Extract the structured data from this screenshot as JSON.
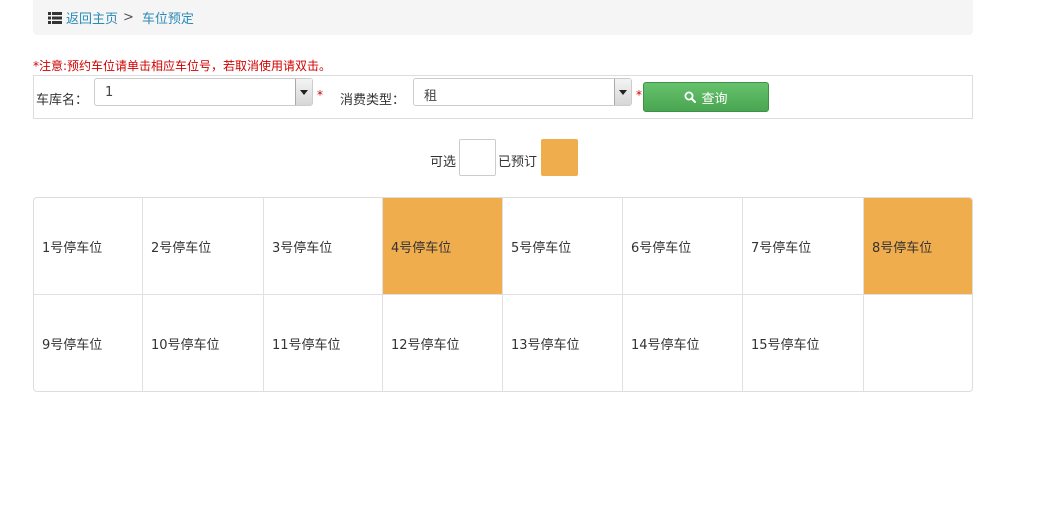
{
  "breadcrumb": {
    "home_label": "返回主页",
    "separator": ">",
    "current": "车位预定"
  },
  "notice": "*注意:预约车位请单击相应车位号，若取消使用请双击。",
  "form": {
    "garage_label": "车库名：",
    "garage_value": "1",
    "type_label": "消费类型：",
    "type_value": "租",
    "required_mark": "*",
    "query_label": "查询"
  },
  "legend": {
    "available_label": "可选",
    "booked_label": "已预订",
    "available_color": "#ffffff",
    "booked_color": "#f0ad4e"
  },
  "slots": [
    {
      "label": "1号停车位",
      "booked": false
    },
    {
      "label": "2号停车位",
      "booked": false
    },
    {
      "label": "3号停车位",
      "booked": false
    },
    {
      "label": "4号停车位",
      "booked": true
    },
    {
      "label": "5号停车位",
      "booked": false
    },
    {
      "label": "6号停车位",
      "booked": false
    },
    {
      "label": "7号停车位",
      "booked": false
    },
    {
      "label": "8号停车位",
      "booked": true
    },
    {
      "label": "9号停车位",
      "booked": false
    },
    {
      "label": "10号停车位",
      "booked": false
    },
    {
      "label": "11号停车位",
      "booked": false
    },
    {
      "label": "12号停车位",
      "booked": false
    },
    {
      "label": "13号停车位",
      "booked": false
    },
    {
      "label": "14号停车位",
      "booked": false
    },
    {
      "label": "15号停车位",
      "booked": false
    },
    {
      "label": "",
      "booked": false
    }
  ]
}
